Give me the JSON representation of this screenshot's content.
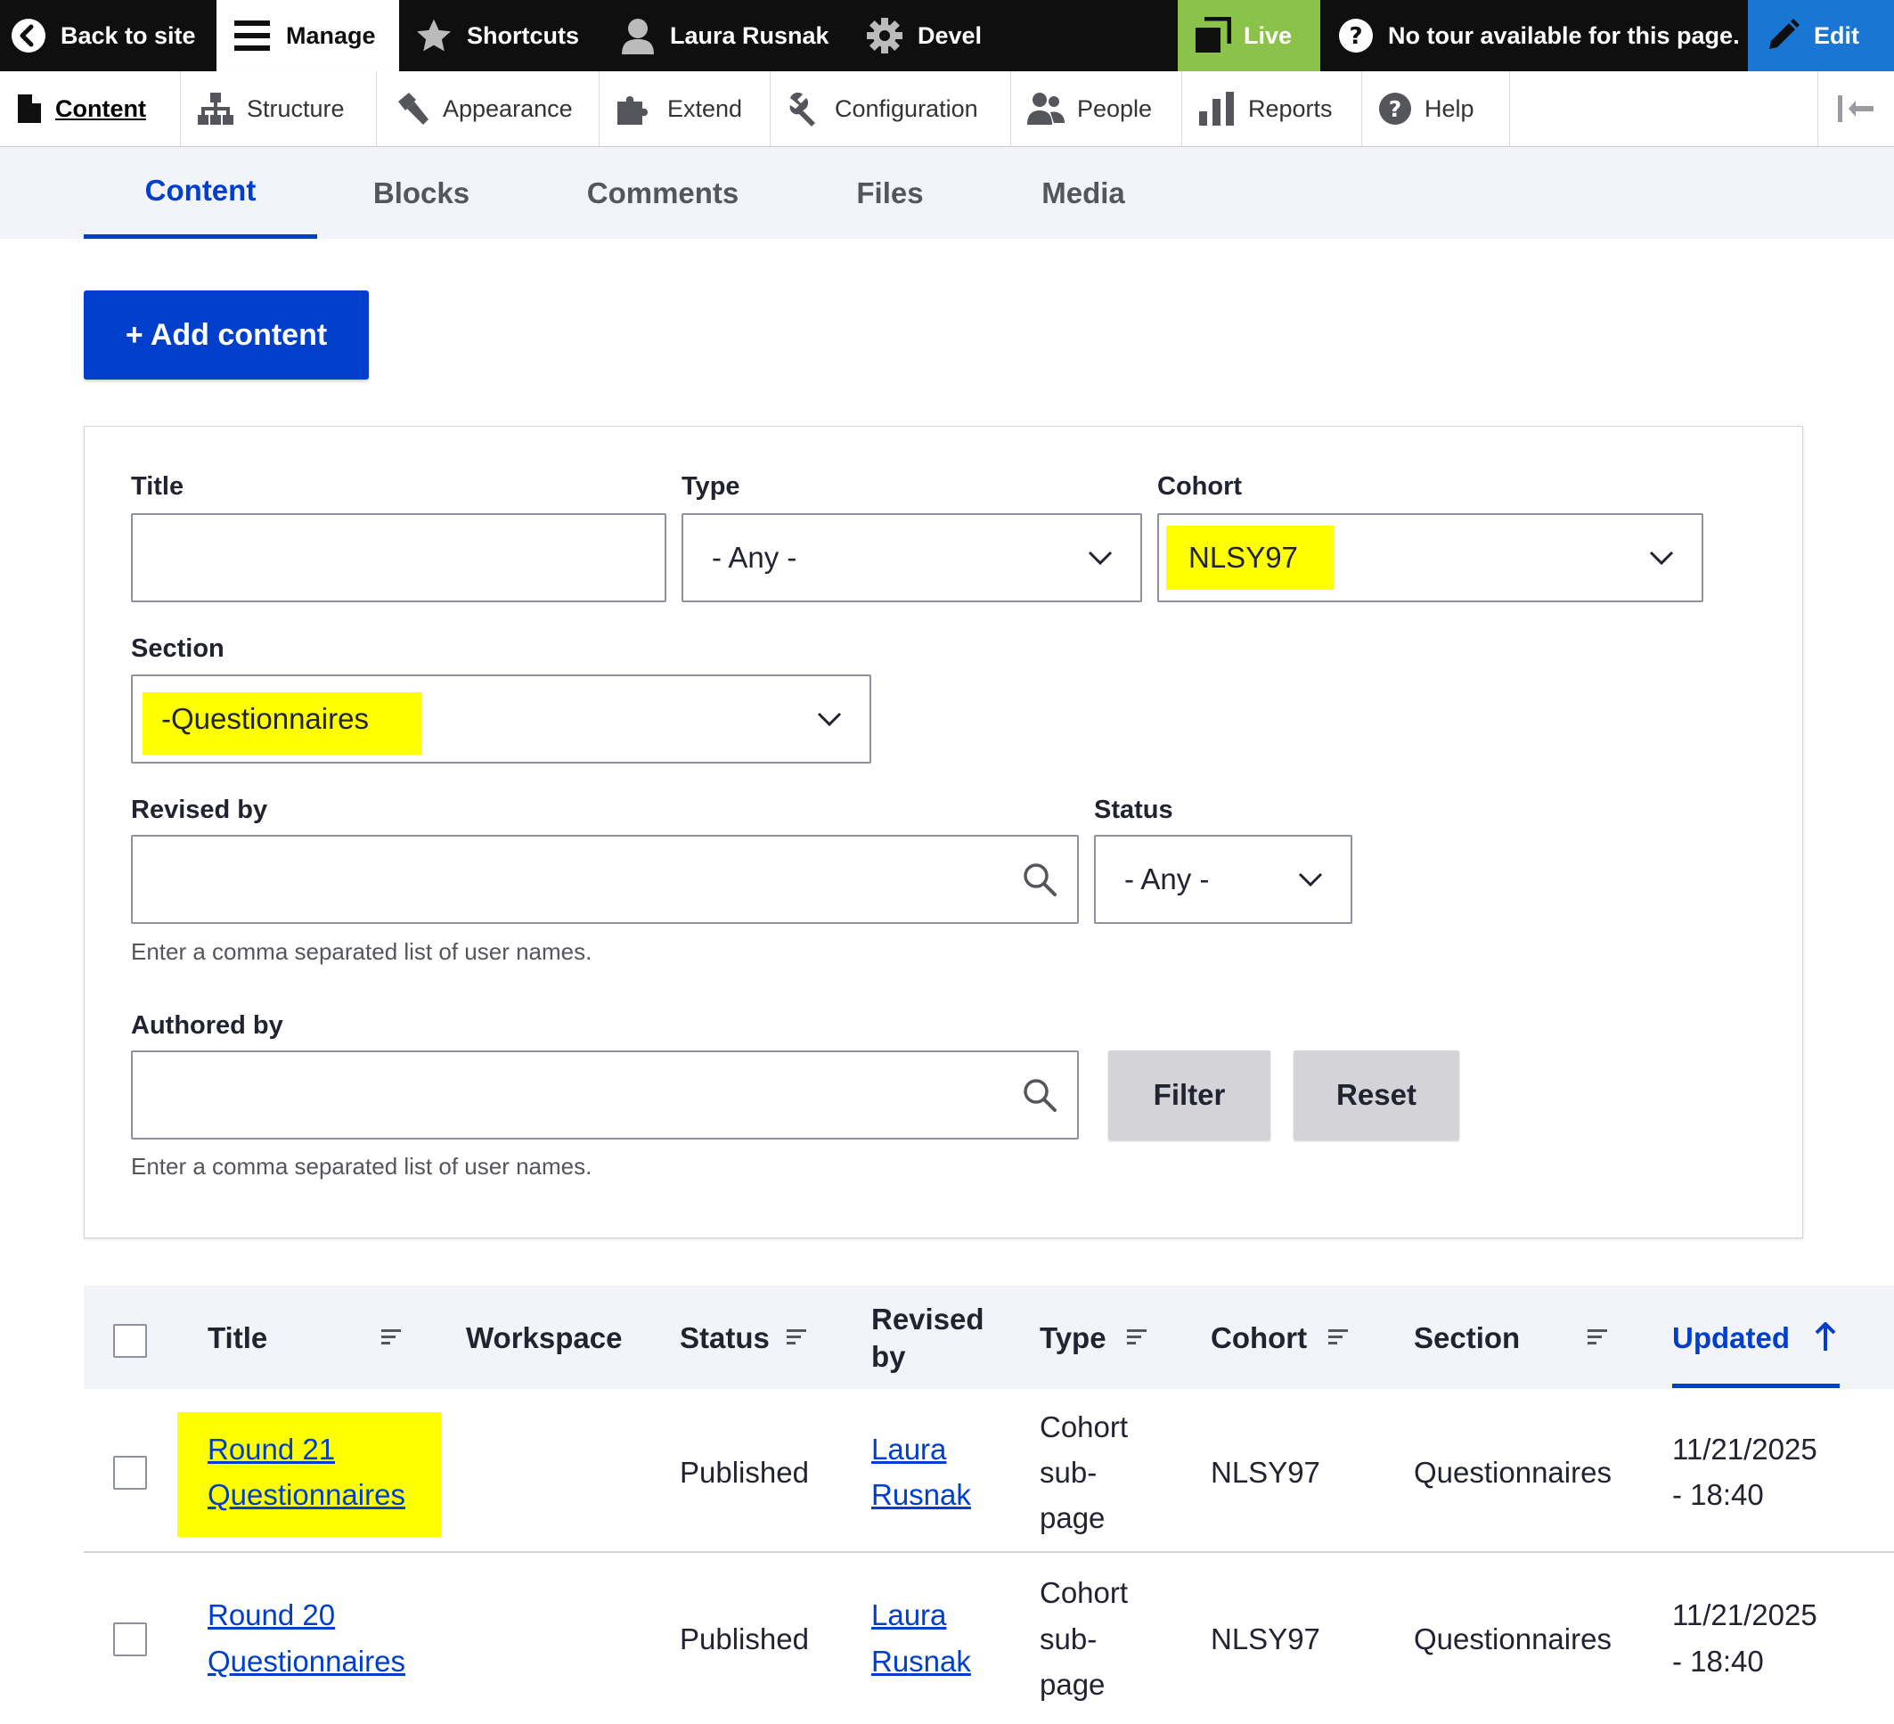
{
  "toolbar": {
    "back": "Back to site",
    "manage": "Manage",
    "shortcuts": "Shortcuts",
    "user": "Laura Rusnak",
    "devel": "Devel",
    "live": "Live",
    "tour": "No tour available for this page.",
    "edit": "Edit"
  },
  "tray": {
    "items": [
      "Content",
      "Structure",
      "Appearance",
      "Extend",
      "Configuration",
      "People",
      "Reports",
      "Help"
    ]
  },
  "tabs": [
    "Content",
    "Blocks",
    "Comments",
    "Files",
    "Media"
  ],
  "add_content": "+ Add content",
  "filters": {
    "title_label": "Title",
    "title_value": "",
    "type_label": "Type",
    "type_value": "- Any -",
    "cohort_label": "Cohort",
    "cohort_value": "NLSY97",
    "section_label": "Section",
    "section_value": "-Questionnaires",
    "revised_label": "Revised by",
    "revised_value": "",
    "revised_help": "Enter a comma separated list of user names.",
    "status_label": "Status",
    "status_value": "- Any -",
    "authored_label": "Authored by",
    "authored_value": "",
    "authored_help": "Enter a comma separated list of user names.",
    "filter_btn": "Filter",
    "reset_btn": "Reset"
  },
  "table": {
    "headers": {
      "title": "Title",
      "workspace": "Workspace",
      "status": "Status",
      "revised_line1": "Revised",
      "revised_line2": "by",
      "type": "Type",
      "cohort": "Cohort",
      "section": "Section",
      "updated": "Updated"
    },
    "rows": [
      {
        "title_line1": "Round 21",
        "title_line2": "Questionnaires",
        "workspace": "",
        "status": "Published",
        "revised_line1": "Laura",
        "revised_line2": "Rusnak",
        "type_line1": "Cohort",
        "type_line2": "sub-",
        "type_line3": "page",
        "cohort": "NLSY97",
        "section": "Questionnaires",
        "updated_line1": "11/21/2025",
        "updated_line2": "- 18:40"
      },
      {
        "title_line1": "Round 20",
        "title_line2": "Questionnaires",
        "workspace": "",
        "status": "Published",
        "revised_line1": "Laura",
        "revised_line2": "Rusnak",
        "type_line1": "Cohort",
        "type_line2": "sub-",
        "type_line3": "page",
        "cohort": "NLSY97",
        "section": "Questionnaires",
        "updated_line1": "11/21/2025",
        "updated_line2": "- 18:40"
      }
    ]
  },
  "colors": {
    "accent": "#003ecc",
    "highlight": "#ffff00",
    "live": "#8bc34a",
    "edit": "#1976d2"
  }
}
